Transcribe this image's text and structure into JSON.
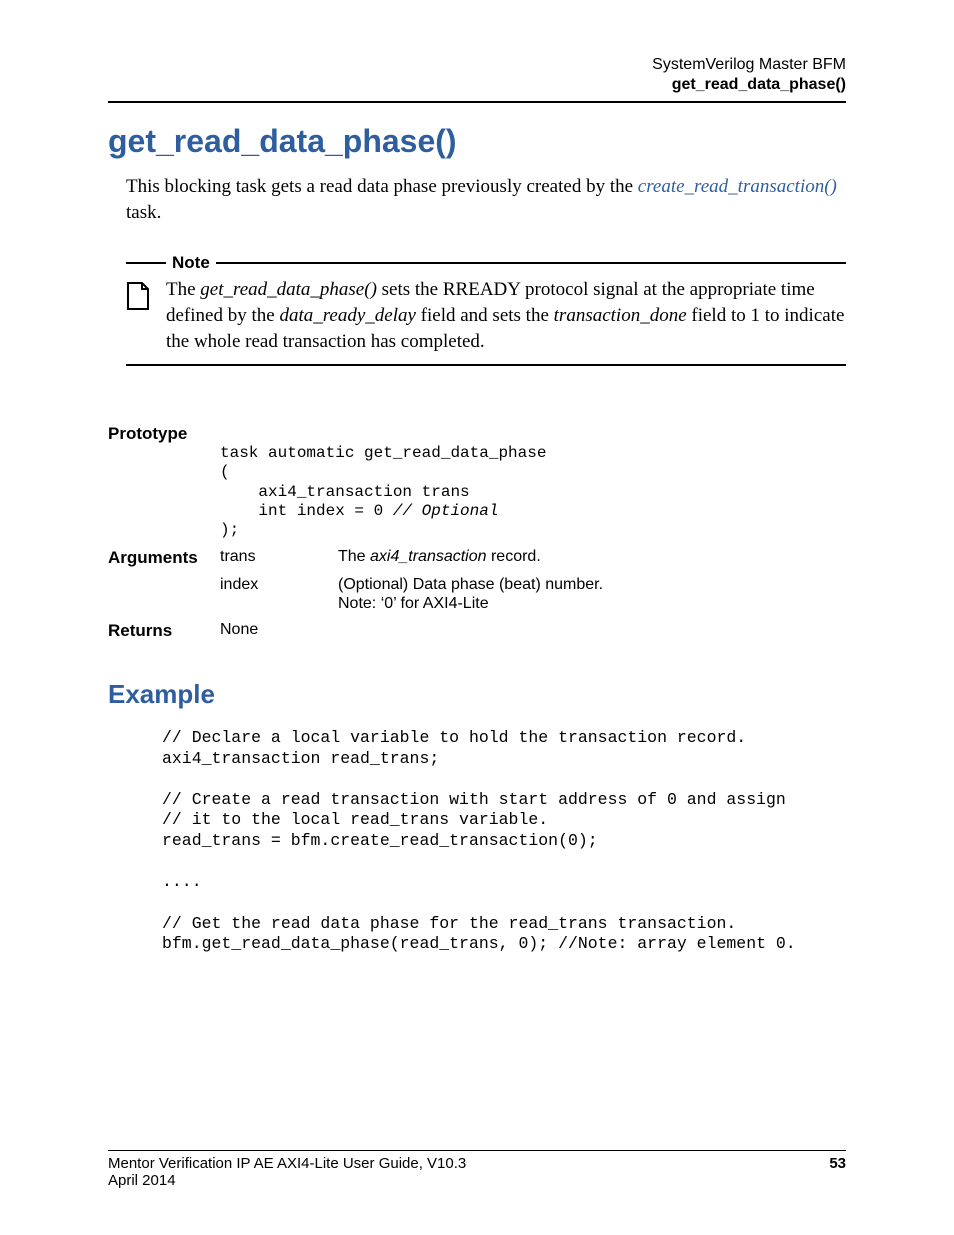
{
  "header": {
    "line1": "SystemVerilog Master BFM",
    "line2": "get_read_data_phase()"
  },
  "title": "get_read_data_phase()",
  "intro": {
    "pre": "This blocking task gets a read data phase previously created by the ",
    "link": "create_read_transaction()",
    "post": " task."
  },
  "note": {
    "label": "Note",
    "p1a": "The ",
    "p1b": "get_read_data_phase()",
    "p1c": " sets the RREADY protocol signal at the appropriate time defined by the ",
    "p1d": "data_ready_delay",
    "p1e": " field and sets the ",
    "p1f": "transaction_done",
    "p1g": " field to 1 to indicate the whole read transaction has completed."
  },
  "table": {
    "prototype_label": "Prototype",
    "code_l1": "task automatic get_read_data_phase",
    "code_l2": "(",
    "code_l3": "    axi4_transaction trans",
    "code_l4a": "    int index = 0 ",
    "code_l4b": "// Optional",
    "code_l5": ");",
    "arguments_label": "Arguments",
    "arg1_name": "trans",
    "arg1_desc_a": "The ",
    "arg1_desc_b": "axi4_transaction",
    "arg1_desc_c": " record.",
    "arg2_name": "index",
    "arg2_desc_l1": "(Optional) Data phase (beat) number.",
    "arg2_desc_l2": "Note: ‘0’ for AXI4-Lite",
    "returns_label": "Returns",
    "returns_val": "None"
  },
  "example": {
    "heading": "Example",
    "code": "// Declare a local variable to hold the transaction record.\naxi4_transaction read_trans;\n\n// Create a read transaction with start address of 0 and assign\n// it to the local read_trans variable.\nread_trans = bfm.create_read_transaction(0);\n\n....\n\n// Get the read data phase for the read_trans transaction.\nbfm.get_read_data_phase(read_trans, 0); //Note: array element 0."
  },
  "footer": {
    "guide": "Mentor Verification IP AE AXI4-Lite User Guide, V10.3",
    "date": "April 2014",
    "page": "53"
  }
}
